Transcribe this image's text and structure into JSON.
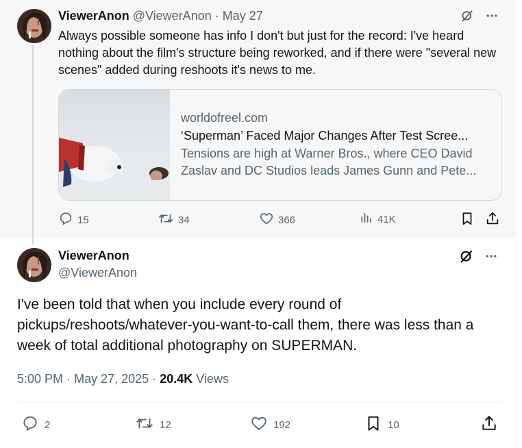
{
  "post1": {
    "author_name": "ViewerAnon",
    "author_handle": "@ViewerAnon",
    "separator": "·",
    "date": "May 27",
    "text": "Always possible someone has info I don't but just for the record: I've heard nothing about the film's structure being reworked, and if there were \"several new scenes\" added during reshoots it's news to me.",
    "card": {
      "domain": "worldofreel.com",
      "title": "‘Superman’ Faced Major Changes After Test Scree...",
      "description": "Tensions are high at Warner Bros., where CEO David Zaslav and DC Studios leads James Gunn and Pete..."
    },
    "metrics": {
      "replies": "15",
      "reposts": "34",
      "likes": "366",
      "views": "41K"
    }
  },
  "post2": {
    "author_name": "ViewerAnon",
    "author_handle": "@ViewerAnon",
    "text": "I've been told that when you include every round of pickups/reshoots/whatever-you-want-to-call them, there was less than a week of total additional photography on SUPERMAN.",
    "time": "5:00 PM",
    "separator": "·",
    "date": "May 27, 2025",
    "separator2": "·",
    "views_count": "20.4K",
    "views_label": "Views",
    "metrics": {
      "replies": "2",
      "reposts": "12",
      "likes": "192",
      "bookmarks": "10"
    }
  },
  "icons": {
    "grok": "grok-icon",
    "more": "more-icon",
    "reply": "reply-icon",
    "repost": "repost-icon",
    "like": "heart-icon",
    "views": "views-icon",
    "bookmark": "bookmark-icon",
    "share": "share-icon"
  },
  "colors": {
    "text_primary": "#0f1419",
    "text_secondary": "#536471",
    "border": "#cfd9de",
    "top_post_bg": "#f7f7f7"
  }
}
